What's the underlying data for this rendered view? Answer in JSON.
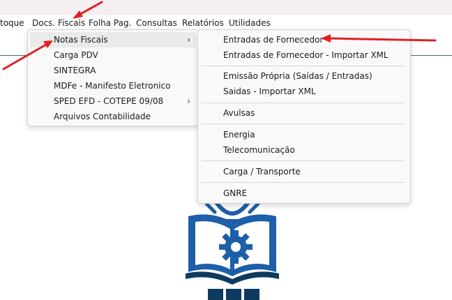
{
  "menubar": {
    "items": [
      {
        "label": "toque"
      },
      {
        "label": "Docs. Fiscais"
      },
      {
        "label": "Folha Pag."
      },
      {
        "label": "Consultas"
      },
      {
        "label": "Relatórios"
      },
      {
        "label": "Utilidades"
      }
    ]
  },
  "docs_menu": {
    "items": [
      {
        "label": "Notas Fiscais",
        "has_submenu": true
      },
      {
        "label": "Carga PDV"
      },
      {
        "label": "SINTEGRA"
      },
      {
        "label": "MDFe - Manifesto Eletronico"
      },
      {
        "label": "SPED EFD - COTEPE 09/08",
        "has_submenu": true
      },
      {
        "label": "Arquivos Contabilidade"
      }
    ]
  },
  "notas_submenu": {
    "items": [
      {
        "label": "Entradas de Fornecedor"
      },
      {
        "label": "Entradas de Fornecedor - Importar XML"
      },
      {
        "label": "Emissão Própria (Saídas / Entradas)"
      },
      {
        "label": "Saidas - Importar XML"
      },
      {
        "label": "Avulsas"
      },
      {
        "label": "Energia"
      },
      {
        "label": "Telecomunicação"
      },
      {
        "label": "Carga / Transporte"
      },
      {
        "label": "GNRE"
      }
    ]
  },
  "submenu_arrow_glyph": "›",
  "colors": {
    "annotation_red": "#e02020",
    "logo_blue": "#1d5fa8",
    "logo_dark": "#0f3a5f",
    "menu_highlight": "#eaeaea"
  },
  "icons": [
    "annotation-arrow-icon",
    "chevron-right-icon",
    "logo-book-gear-icon"
  ]
}
